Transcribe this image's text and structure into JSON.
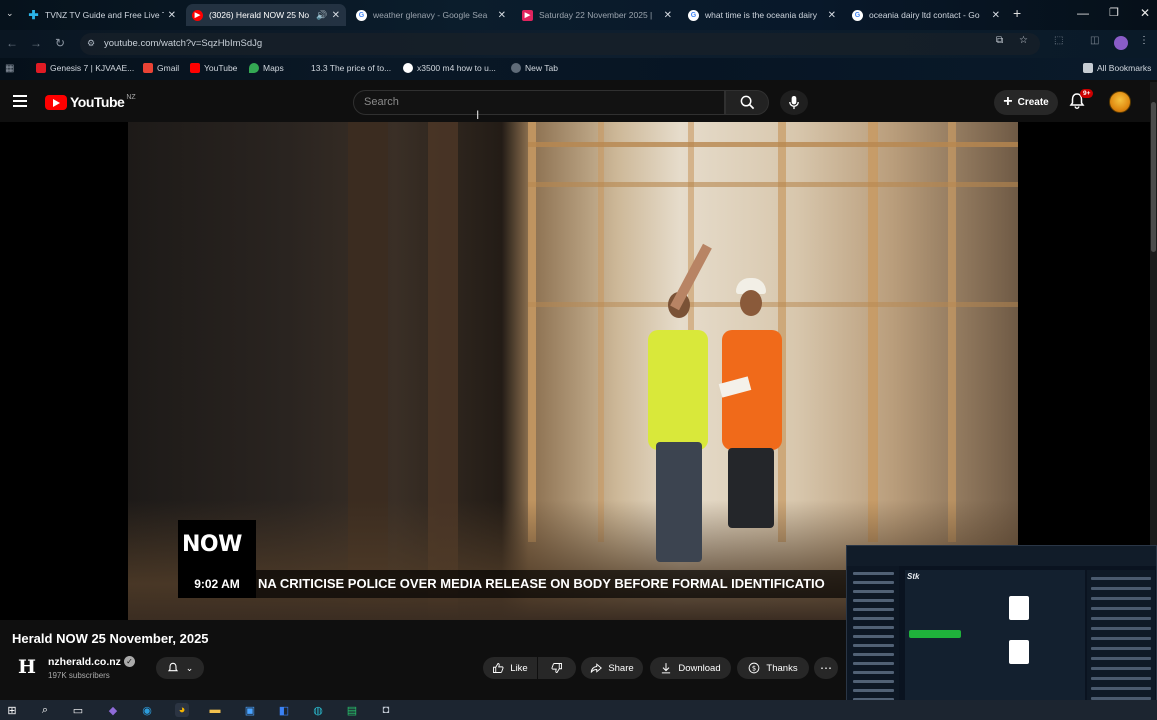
{
  "browser": {
    "tabs": [
      {
        "title": "TVNZ TV Guide and Free Live T",
        "icon": "tvnz-icon",
        "active": false
      },
      {
        "title": "(3026) Herald NOW 25 No",
        "icon": "youtube-icon",
        "active": true
      },
      {
        "title": "weather glenavy - Google Sea",
        "icon": "google-icon",
        "active": false
      },
      {
        "title": "Saturday 22 November 2025 | ",
        "icon": "bookmark-icon",
        "active": false
      },
      {
        "title": "what time is the oceania dairy",
        "icon": "google-icon",
        "active": false
      },
      {
        "title": "oceania dairy ltd contact - Go",
        "icon": "google-icon",
        "active": false
      }
    ],
    "url": "youtube.com/watch?v=SqzHbImSdJg",
    "bookmarks": [
      {
        "label": "Genesis 7 | KJVAAE...",
        "color": "#e01b24"
      },
      {
        "label": "Gmail",
        "color": "#ea4335"
      },
      {
        "label": "YouTube",
        "color": "#ff0000"
      },
      {
        "label": "Maps",
        "color": "#34a853"
      },
      {
        "label": "13.3 The price of to...",
        "color": "#5f6b78"
      },
      {
        "label": "x3500 m4 how to u...",
        "color": "#8ab4f8"
      },
      {
        "label": "New Tab",
        "color": "#8ab4f8"
      }
    ],
    "all_bookmarks": "All Bookmarks"
  },
  "youtube": {
    "logo_word": "YouTube",
    "country": "NZ",
    "search_placeholder": "Search",
    "create_label": "Create",
    "notifications_badge": "9+"
  },
  "video": {
    "now_logo": "NOW",
    "ticker_time": "9:02 AM",
    "ticker_text": "NA CRITICISE POLICE OVER MEDIA RELEASE ON BODY BEFORE FORMAL IDENTIFICATIO",
    "title": "Herald NOW 25 November, 2025"
  },
  "channel": {
    "name": "nzherald.co.nz",
    "subscribers": "197K subscribers",
    "logo_letter": "H"
  },
  "actions": {
    "like": "Like",
    "share": "Share",
    "download": "Download",
    "thanks": "Thanks"
  },
  "colors": {
    "yt_red": "#ff0000",
    "background": "#0f0f0f",
    "pill": "#272727"
  }
}
